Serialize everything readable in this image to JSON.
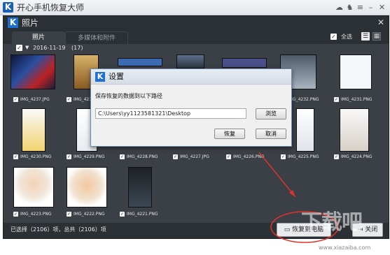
{
  "app": {
    "title": "开心手机恢复大师",
    "logo_letter": "K",
    "titlebar_icons": [
      {
        "name": "chat-icon",
        "glyph": "☁"
      },
      {
        "name": "shirt-icon",
        "glyph": "♞"
      },
      {
        "name": "menu-icon",
        "glyph": "≡"
      },
      {
        "name": "minimize-icon",
        "glyph": "–"
      },
      {
        "name": "close-icon",
        "glyph": "✕"
      }
    ]
  },
  "window": {
    "title": "照片",
    "logo_letter": "K",
    "close_glyph": "✕"
  },
  "tabs": [
    {
      "label": "照片",
      "active": true
    },
    {
      "label": "多媒体和附件",
      "active": false
    }
  ],
  "toolbar": {
    "select_all_label": "全选",
    "view_list_glyph": "☰",
    "view_grid_glyph": "▦"
  },
  "group": {
    "date": "2016-11-19",
    "count": "(17)"
  },
  "files": [
    {
      "name": "IMG_4237.JPG",
      "checked": true,
      "hidden": false
    },
    {
      "name": "IMG_4236",
      "checked": true,
      "hidden": false
    },
    {
      "name": "",
      "checked": true,
      "hidden": true
    },
    {
      "name": "",
      "checked": true,
      "hidden": true
    },
    {
      "name": "",
      "checked": true,
      "hidden": true
    },
    {
      "name": "IMG_4232.PNG",
      "checked": true,
      "hidden": false
    },
    {
      "name": "IMG_4231.PNG",
      "checked": true,
      "hidden": false
    },
    {
      "name": "IMG_4230.PNG",
      "checked": true,
      "hidden": false
    },
    {
      "name": "IMG_4229.PNG",
      "checked": true,
      "hidden": false
    },
    {
      "name": "IMG_4228.PNG",
      "checked": true,
      "hidden": false
    },
    {
      "name": "IMG_4227.JPG",
      "checked": true,
      "hidden": false
    },
    {
      "name": "IMG_4226.PNG",
      "checked": true,
      "hidden": false
    },
    {
      "name": "IMG_4225.PNG",
      "checked": true,
      "hidden": false
    },
    {
      "name": "IMG_4224.PNG",
      "checked": true,
      "hidden": false
    },
    {
      "name": "IMG_4223.PNG",
      "checked": true,
      "hidden": false
    },
    {
      "name": "IMG_4222.PNG",
      "checked": true,
      "hidden": false
    },
    {
      "name": "IMG_4221.PNG",
      "checked": true,
      "hidden": false
    }
  ],
  "status": {
    "text": "已选择（2106）项，总共（2106）项"
  },
  "buttons": {
    "recover_to_pc": "恢复到电脑",
    "close": "关闭"
  },
  "dialog": {
    "title": "设置",
    "logo_letter": "K",
    "prompt": "保存恢复的数据到以下路径",
    "path_value": "C:\\Users\\yy1123581321\\Desktop",
    "browse_label": "浏览",
    "ok_label": "恢复",
    "cancel_label": "取消"
  },
  "watermark": {
    "text": "下载吧",
    "url": "www.xiazaiba.com"
  },
  "colors": {
    "dark_bg": "#2b3035",
    "panel_bg": "#3b4046",
    "brand_blue": "#1d6fd6",
    "annotation_red": "#e0312b"
  }
}
